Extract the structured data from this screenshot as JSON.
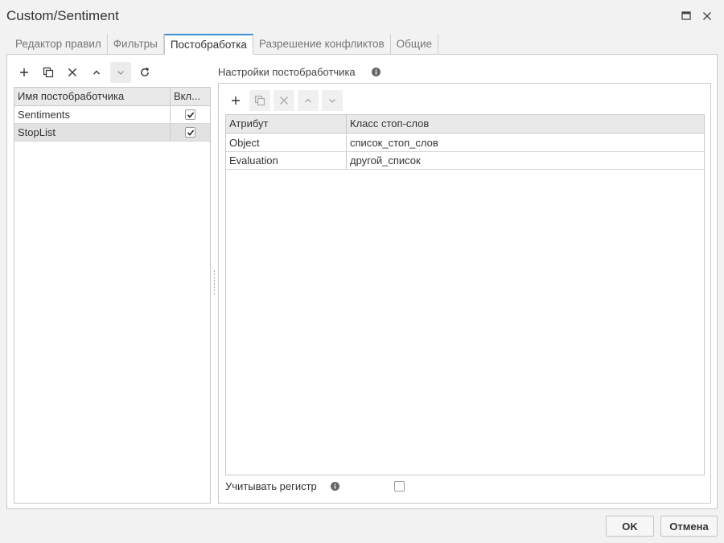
{
  "window": {
    "title": "Custom/Sentiment"
  },
  "tabs": [
    {
      "label": "Редактор правил",
      "active": false
    },
    {
      "label": "Фильтры",
      "active": false
    },
    {
      "label": "Постобработка",
      "active": true
    },
    {
      "label": "Разрешение конфликтов",
      "active": false
    },
    {
      "label": "Общие",
      "active": false
    }
  ],
  "postprocessors": {
    "toolbar": [
      "add-icon",
      "copy-icon",
      "delete-icon",
      "move-up-icon",
      "move-down-icon",
      "refresh-icon"
    ],
    "columns": {
      "name": "Имя постобработчика",
      "enabled": "Вкл..."
    },
    "rows": [
      {
        "name": "Sentiments",
        "enabled": true,
        "selected": false
      },
      {
        "name": "StopList",
        "enabled": true,
        "selected": true
      }
    ]
  },
  "settings": {
    "title": "Настройки постобработчика",
    "columns": {
      "attribute": "Атрибут",
      "stopword_class": "Класс стоп-слов"
    },
    "rows": [
      {
        "attribute": "Object",
        "stopword_class": "список_стоп_слов"
      },
      {
        "attribute": "Evaluation",
        "stopword_class": "другой_список"
      }
    ],
    "case_sensitive_label": "Учитывать регистр",
    "case_sensitive": false
  },
  "footer": {
    "ok": "OK",
    "cancel": "Отмена"
  },
  "colors": {
    "accent": "#3b8fd6",
    "header_bg": "#e9e9e9",
    "selected_row": "#e2e2e2"
  }
}
